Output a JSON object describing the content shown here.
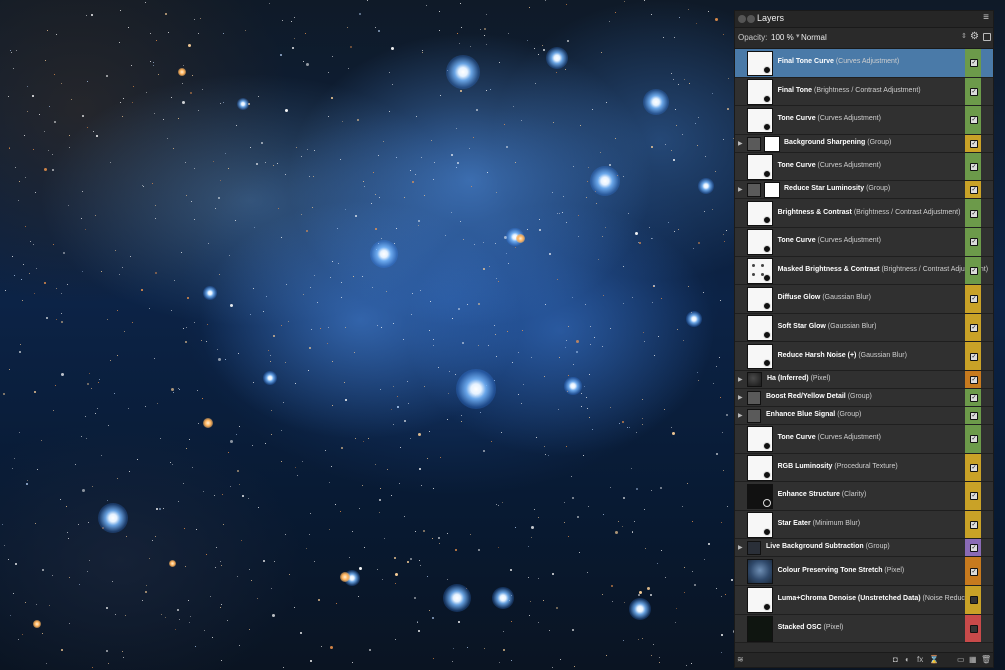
{
  "panel": {
    "title": "Layers",
    "menu_icon": "≡",
    "opacity_label": "Opacity:",
    "opacity_value": "100 %",
    "blend_mode": "Normal"
  },
  "layers": [
    {
      "name": "Final Tone Curve",
      "type": "(Curves Adjustment)",
      "thumb": "white",
      "expander": false,
      "visible": true,
      "color": "#6c9a4a",
      "selected": true
    },
    {
      "name": "Final Tone",
      "type": "(Brightness / Contrast Adjustment)",
      "thumb": "white",
      "expander": false,
      "visible": true,
      "color": "#6c9a4a",
      "selected": false
    },
    {
      "name": "Tone Curve",
      "type": "(Curves Adjustment)",
      "thumb": "white",
      "expander": false,
      "visible": true,
      "color": "#6c9a4a",
      "selected": false
    },
    {
      "name": "Background Sharpening",
      "type": "(Group)",
      "thumb": "folder-mask",
      "expander": true,
      "visible": true,
      "color": "#c9a227",
      "selected": false
    },
    {
      "name": "Tone Curve",
      "type": "(Curves Adjustment)",
      "thumb": "white",
      "expander": false,
      "visible": true,
      "color": "#6c9a4a",
      "selected": false
    },
    {
      "name": "Reduce Star Luminosity",
      "type": "(Group)",
      "thumb": "folder-mask",
      "expander": true,
      "visible": true,
      "color": "#c9a227",
      "selected": false
    },
    {
      "name": "Brightness & Contrast",
      "type": "(Brightness / Contrast Adjustment)",
      "thumb": "white",
      "expander": false,
      "visible": true,
      "color": "#6c9a4a",
      "selected": false
    },
    {
      "name": "Tone Curve",
      "type": "(Curves Adjustment)",
      "thumb": "white",
      "expander": false,
      "visible": true,
      "color": "#6c9a4a",
      "selected": false
    },
    {
      "name": "Masked Brightness & Contrast",
      "type": "(Brightness / Contrast Adjustment)",
      "thumb": "dots",
      "expander": false,
      "visible": true,
      "color": "#6c9a4a",
      "selected": false
    },
    {
      "name": "Diffuse Glow",
      "type": "(Gaussian Blur)",
      "thumb": "white",
      "expander": false,
      "visible": true,
      "color": "#c9a227",
      "selected": false
    },
    {
      "name": "Soft Star Glow",
      "type": "(Gaussian Blur)",
      "thumb": "white",
      "expander": false,
      "visible": true,
      "color": "#c9a227",
      "selected": false
    },
    {
      "name": "Reduce Harsh Noise (+)",
      "type": "(Gaussian Blur)",
      "thumb": "white",
      "expander": false,
      "visible": true,
      "color": "#c9a227",
      "selected": false
    },
    {
      "name": "Ha (Inferred)",
      "type": "(Pixel)",
      "thumb": "noise",
      "expander": true,
      "visible": true,
      "color": "#c77a1e",
      "selected": false
    },
    {
      "name": "Boost Red/Yellow Detail",
      "type": "(Group)",
      "thumb": "folder",
      "expander": true,
      "visible": true,
      "color": "#6c9a4a",
      "selected": false
    },
    {
      "name": "Enhance Blue Signal",
      "type": "(Group)",
      "thumb": "folder",
      "expander": true,
      "visible": true,
      "color": "#6c9a4a",
      "selected": false
    },
    {
      "name": "Tone Curve",
      "type": "(Curves Adjustment)",
      "thumb": "white",
      "expander": false,
      "visible": true,
      "color": "#6c9a4a",
      "selected": false
    },
    {
      "name": "RGB Luminosity",
      "type": "(Procedural Texture)",
      "thumb": "white",
      "expander": false,
      "visible": true,
      "color": "#c9a227",
      "selected": false
    },
    {
      "name": "Enhance Structure",
      "type": "(Clarity)",
      "thumb": "black",
      "expander": false,
      "visible": true,
      "color": "#c9a227",
      "selected": false
    },
    {
      "name": "Star Eater",
      "type": "(Minimum Blur)",
      "thumb": "white",
      "expander": false,
      "visible": true,
      "color": "#c9a227",
      "selected": false
    },
    {
      "name": "Live Background Subtraction",
      "type": "(Group)",
      "thumb": "dark",
      "expander": true,
      "visible": true,
      "color": "#8a6bb5",
      "selected": false
    },
    {
      "name": "Colour Preserving Tone Stretch",
      "type": "(Pixel)",
      "thumb": "photo",
      "expander": false,
      "visible": true,
      "color": "#c77a1e",
      "selected": false
    },
    {
      "name": "Luma+Chroma Denoise (Unstretched Data)",
      "type": "(Noise Reduction)",
      "thumb": "white",
      "expander": false,
      "visible": false,
      "color": "#c9a227",
      "selected": false
    },
    {
      "name": "Stacked OSC",
      "type": "(Pixel)",
      "thumb": "stacked",
      "expander": false,
      "visible": false,
      "color": "#c84a4a",
      "selected": false
    }
  ],
  "footer": {
    "icons": [
      "layers-icon",
      "mask-icon",
      "adjustment-icon",
      "fx-icon",
      "live-filter-icon",
      "group-icon",
      "add-layer-icon",
      "delete-icon"
    ],
    "fx_label": "fx"
  }
}
